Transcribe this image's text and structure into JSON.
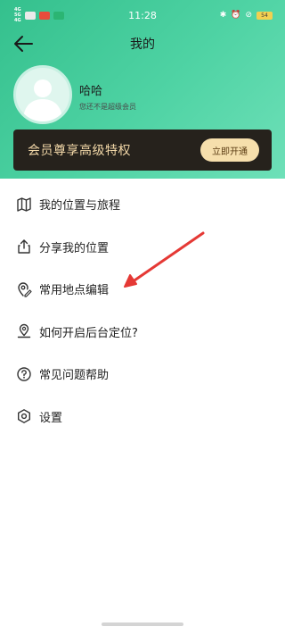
{
  "status": {
    "signal_text": "4G\n5G\n4G",
    "time": "11:28",
    "battery": "54"
  },
  "header": {
    "title": "我的"
  },
  "user": {
    "name": "哈哈",
    "subtitle": "您还不是超级会员"
  },
  "vip": {
    "banner_text": "会员尊享高级特权",
    "button_label": "立即开通"
  },
  "menu": {
    "items": [
      {
        "label": "我的位置与旅程",
        "icon": "map-icon"
      },
      {
        "label": "分享我的位置",
        "icon": "share-icon"
      },
      {
        "label": "常用地点编辑",
        "icon": "location-edit-icon"
      },
      {
        "label": "如何开启后台定位?",
        "icon": "location-pin-icon"
      },
      {
        "label": "常见问题帮助",
        "icon": "help-icon"
      },
      {
        "label": "设置",
        "icon": "settings-icon"
      }
    ]
  },
  "colors": {
    "header_gradient_start": "#34c08d",
    "header_gradient_end": "#6ee0b8",
    "vip_background": "#26221c",
    "vip_text": "#f1d7a7",
    "vip_button": "#f6dfac",
    "annotation_arrow": "#e53935"
  }
}
